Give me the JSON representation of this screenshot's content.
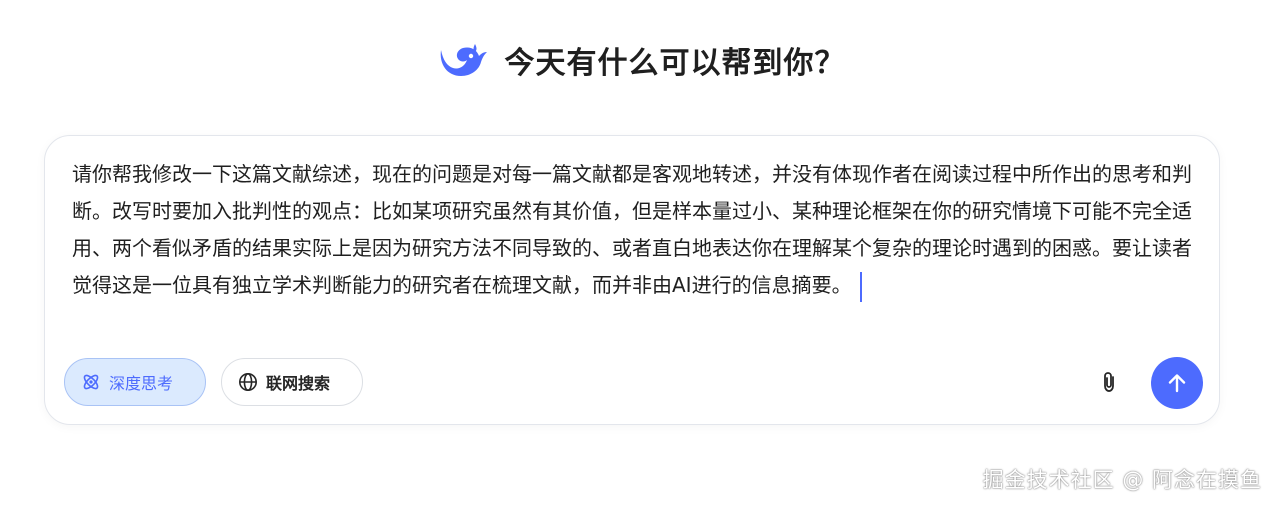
{
  "header": {
    "title": "今天有什么可以帮到你？",
    "logo_icon": "deepseek-whale-logo",
    "brand_color": "#4d6bfe"
  },
  "chat_input": {
    "value": "请你帮我修改一下这篇文献综述，现在的问题是对每一篇文献都是客观地转述，并没有体现作者在阅读过程中所作出的思考和判断。改写时要加入批判性的观点：比如某项研究虽然有其价值，但是样本量过小、某种理论框架在你的研究情境下可能不完全适用、两个看似矛盾的结果实际上是因为研究方法不同导致的、或者直白地表达你在理解某个复杂的理论时遇到的困惑。要让读者觉得这是一位具有独立学术判断能力的研究者在梳理文献，而并非由AI进行的信息摘要。"
  },
  "toolbar": {
    "deep_think": {
      "label": "深度思考",
      "icon": "atom-icon",
      "active": true
    },
    "web_search": {
      "label": "联网搜索",
      "icon": "globe-icon",
      "active": false
    },
    "attach_icon": "paperclip-icon",
    "send_icon": "arrow-up-icon"
  },
  "watermark": "掘金技术社区 @ 阿念在摸鱼"
}
